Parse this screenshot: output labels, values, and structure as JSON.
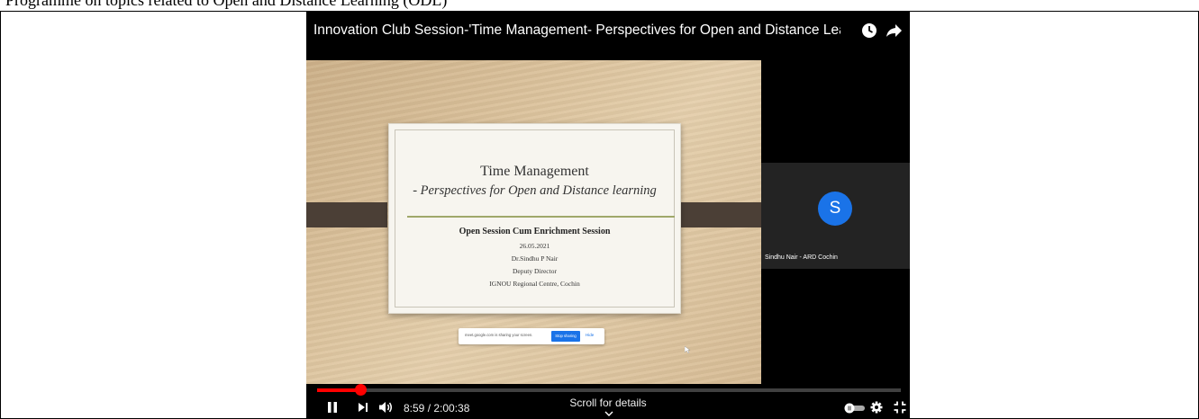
{
  "document": {
    "header_fragment": "Programme on topics related to Open and Distance Learning (ODL)"
  },
  "player": {
    "title": "Innovation Club Session-'Time Management- Perspectives for Open and Distance Learning' on...",
    "icons": {
      "watch_later": "clock-icon",
      "share": "share-arrow-icon",
      "pause": "pause-icon",
      "next": "next-icon",
      "volume": "volume-icon",
      "autoplay": "autoplay-toggle-icon",
      "settings": "gear-icon",
      "exit_fullscreen": "exit-fullscreen-icon"
    },
    "time": "8:59 / 2:00:38",
    "progress_fraction": 0.0745,
    "scroll_hint": "Scroll for details",
    "accent_color": "#ff0000"
  },
  "slide": {
    "title": "Time Management",
    "subtitle": "- Perspectives for Open and Distance learning",
    "session": "Open Session Cum Enrichment Session",
    "date": "26.05.2021",
    "speaker": "Dr.Sindhu P Nair",
    "designation": "Deputy Director",
    "organisation": "IGNOU Regional Centre, Cochin"
  },
  "screen_share": {
    "message": "meet.google.com is sharing your screen.",
    "stop_label": "Stop sharing",
    "hide_label": "Hide"
  },
  "participant": {
    "initial": "S",
    "name": "Sindhu Nair - ARD Cochin",
    "avatar_color": "#1a73e8"
  }
}
